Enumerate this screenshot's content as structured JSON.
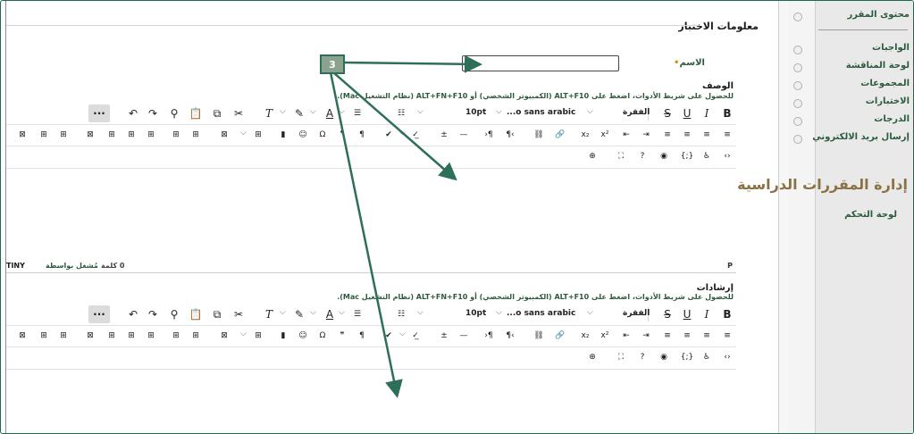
{
  "sidebar": {
    "items": [
      {
        "label": "محتوى المقرر"
      },
      {
        "label": "الواجبات"
      },
      {
        "label": "لوحة المناقشة"
      },
      {
        "label": "المجموعات"
      },
      {
        "label": "الاختبارات"
      },
      {
        "label": "الدرجات"
      },
      {
        "label": "إرسال بريد الالكتروني"
      }
    ],
    "section_heading": "إدارة المقررات الدراسية",
    "control_panel": "لوحة التحكم"
  },
  "main": {
    "section_title": "معلومات الاختبار",
    "name_label": "الاسم",
    "required_mark": "•",
    "description_label": "الوصف",
    "instructions_label": "إرشادات",
    "toolbar_hint": "للحصول على شريط الأدوات، اضغط على ALT+F10 (الكمبيوتر الشخصي) أو ALT+FN+F10 (نظام التشغيل Mac).",
    "toolbar": {
      "paragraph": "الفقرة",
      "font": "...o sans arabic",
      "size": "10pt"
    },
    "status": {
      "path": "P",
      "words": "0 كلمة",
      "powered_by": "مُشغل بواسطة",
      "brand": "TINY"
    }
  },
  "annotation": {
    "step": "3"
  },
  "colors": {
    "accent": "#2e6f58",
    "label_green": "#2d5a3d",
    "heading_brown": "#8a7245"
  }
}
